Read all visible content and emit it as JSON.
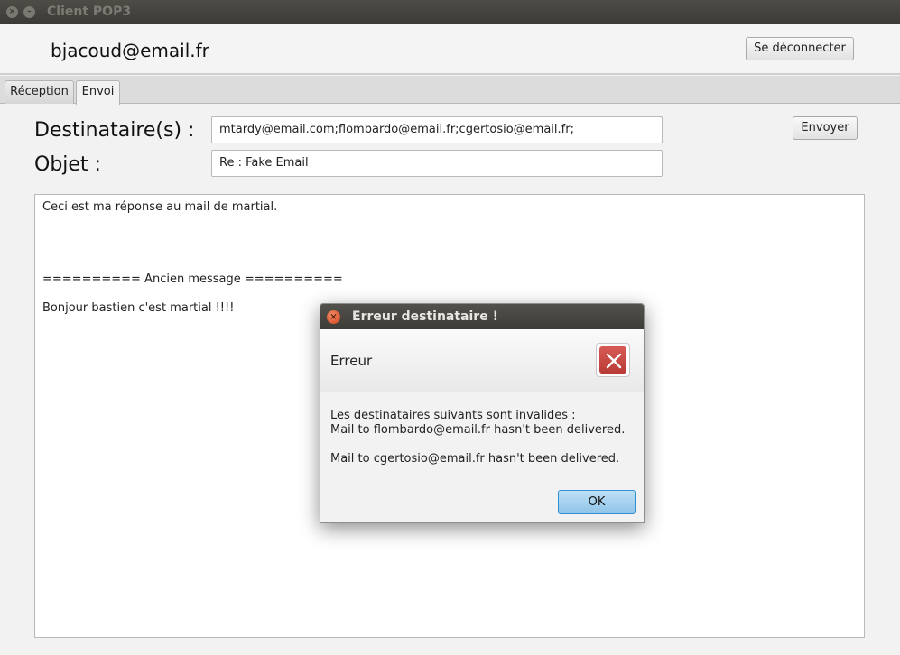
{
  "window": {
    "title": "Client POP3",
    "close_glyph": "×",
    "min_glyph": "–"
  },
  "header": {
    "user_email": "bjacoud@email.fr",
    "logout_label": "Se déconnecter"
  },
  "tabs": [
    {
      "label": "Réception",
      "active": false
    },
    {
      "label": "Envoi",
      "active": true
    }
  ],
  "compose": {
    "recipients_label": "Destinataire(s) :",
    "recipients_value": "mtardy@email.com;flombardo@email.fr;cgertosio@email.fr;",
    "subject_label": "Objet :",
    "subject_value": "Re : Fake Email",
    "send_label": "Envoyer",
    "body_lines": [
      "Ceci est ma réponse au mail de martial.",
      "========== Ancien message ==========",
      "Bonjour bastien c'est martial !!!!"
    ]
  },
  "dialog": {
    "title": "Erreur destinataire !",
    "close_glyph": "×",
    "header": "Erreur",
    "icon": "error-x-icon",
    "lines": [
      "Les destinataires suivants sont invalides :",
      "Mail to flombardo@email.fr hasn't been delivered.",
      "",
      "Mail to cgertosio@email.fr hasn't been delivered."
    ],
    "ok_label": "OK"
  },
  "colors": {
    "titlebar": "#3d3c38",
    "ok_accent": "#2f8fd3",
    "error_icon": "#c9473f"
  }
}
